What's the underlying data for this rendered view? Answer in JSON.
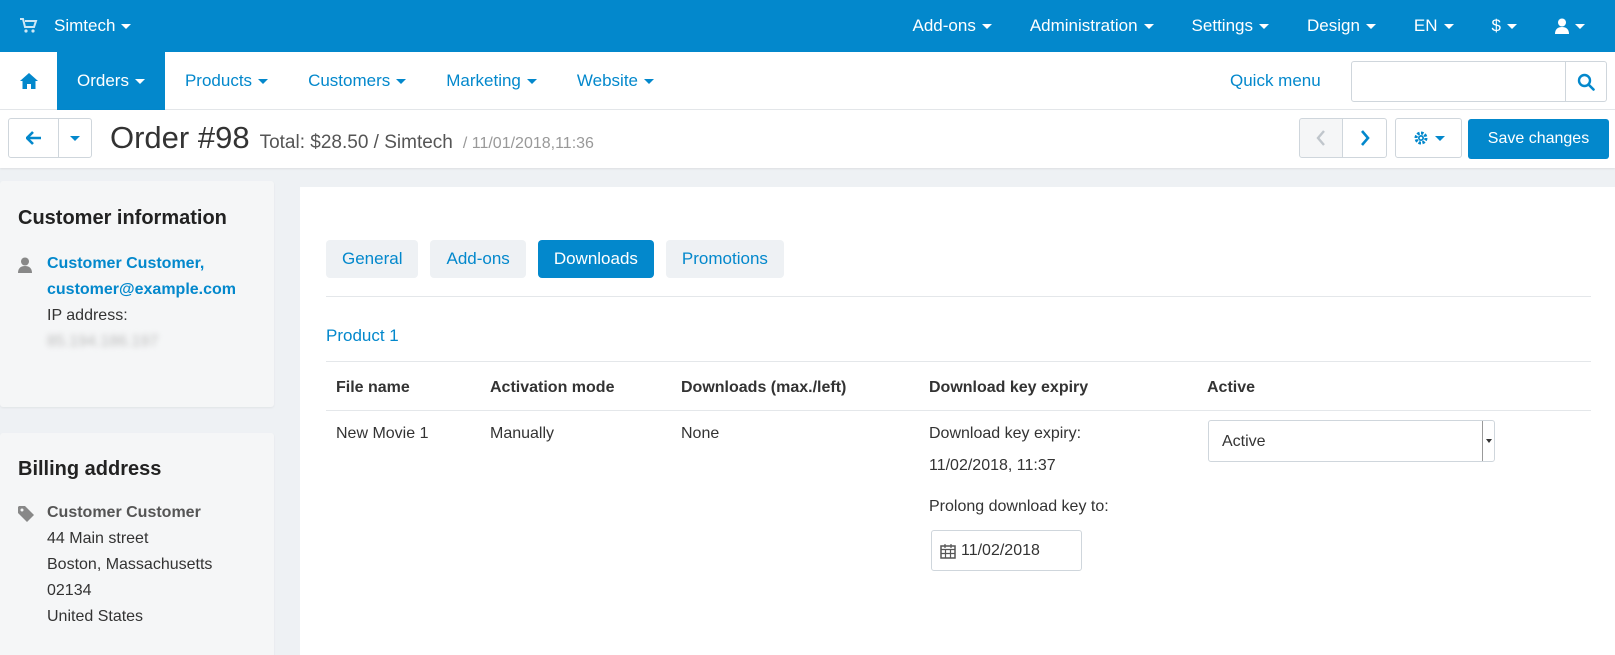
{
  "topbar": {
    "store_name": "Simtech",
    "menu": [
      {
        "label": "Add-ons"
      },
      {
        "label": "Administration"
      },
      {
        "label": "Settings"
      },
      {
        "label": "Design"
      },
      {
        "label": "EN"
      },
      {
        "label": "$"
      }
    ]
  },
  "navbar": {
    "items": [
      {
        "label": "Orders",
        "active": true
      },
      {
        "label": "Products"
      },
      {
        "label": "Customers"
      },
      {
        "label": "Marketing"
      },
      {
        "label": "Website"
      }
    ],
    "quick_menu": "Quick menu",
    "search_value": ""
  },
  "order": {
    "title": "Order #98",
    "total": "Total: $28.50 / Simtech",
    "date": "/ 11/01/2018,11:36",
    "save_label": "Save changes"
  },
  "customer_info": {
    "heading": "Customer information",
    "name": "Customer Customer,",
    "email": "customer@example.com",
    "ip_label": "IP address:",
    "ip_value": "85.194.186.197"
  },
  "billing": {
    "heading": "Billing address",
    "name": "Customer Customer",
    "street": "44 Main street",
    "city": "Boston, Massachusetts",
    "zip": "02134",
    "country": "United States"
  },
  "tabs": [
    {
      "label": "General"
    },
    {
      "label": "Add-ons"
    },
    {
      "label": "Downloads",
      "active": true
    },
    {
      "label": "Promotions"
    }
  ],
  "downloads": {
    "product": "Product 1",
    "headers": [
      "File name",
      "Activation mode",
      "Downloads (max./left)",
      "Download key expiry",
      "Active"
    ],
    "row": {
      "file_name": "New Movie 1",
      "activation_mode": "Manually",
      "downloads": "None",
      "expiry_label": "Download key expiry:",
      "expiry_value": "11/02/2018, 11:37",
      "prolong_label": "Prolong download key to:",
      "prolong_date": "11/02/2018",
      "active_value": "Active"
    }
  },
  "colors": {
    "primary": "#0388cc",
    "background": "#eef1f4"
  }
}
